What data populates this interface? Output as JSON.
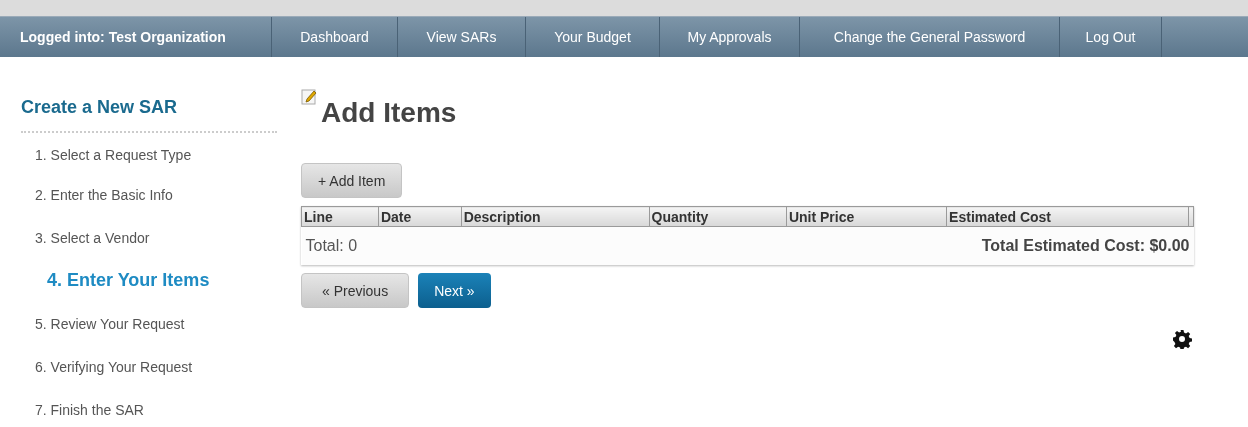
{
  "nav": {
    "org_label": "Logged into: Test Organization",
    "items": [
      {
        "label": "Dashboard"
      },
      {
        "label": "View SARs"
      },
      {
        "label": "Your Budget"
      },
      {
        "label": "My Approvals"
      },
      {
        "label": "Change the General Password"
      },
      {
        "label": "Log Out"
      }
    ]
  },
  "sidebar": {
    "title": "Create a New SAR",
    "steps": [
      {
        "label": "1. Select a Request Type",
        "selected": false
      },
      {
        "label": "2. Enter the Basic Info",
        "selected": false
      },
      {
        "label": "3. Select a Vendor",
        "selected": false
      },
      {
        "label": "4. Enter Your Items",
        "selected": true
      },
      {
        "label": "5. Review Your Request",
        "selected": false
      },
      {
        "label": "6. Verifying Your Request",
        "selected": false
      },
      {
        "label": "7. Finish the SAR",
        "selected": false
      }
    ]
  },
  "main": {
    "title": "Add Items",
    "add_button": "+ Add Item",
    "table": {
      "columns": [
        "Line",
        "Date",
        "Description",
        "Quantity",
        "Unit Price",
        "Estimated Cost"
      ],
      "total_count": "Total: 0",
      "total_cost": "Total Estimated Cost: $0.00"
    },
    "buttons": [
      {
        "label": "« Previous",
        "kind": "secondary"
      },
      {
        "label": "Next »",
        "kind": "primary"
      }
    ]
  }
}
